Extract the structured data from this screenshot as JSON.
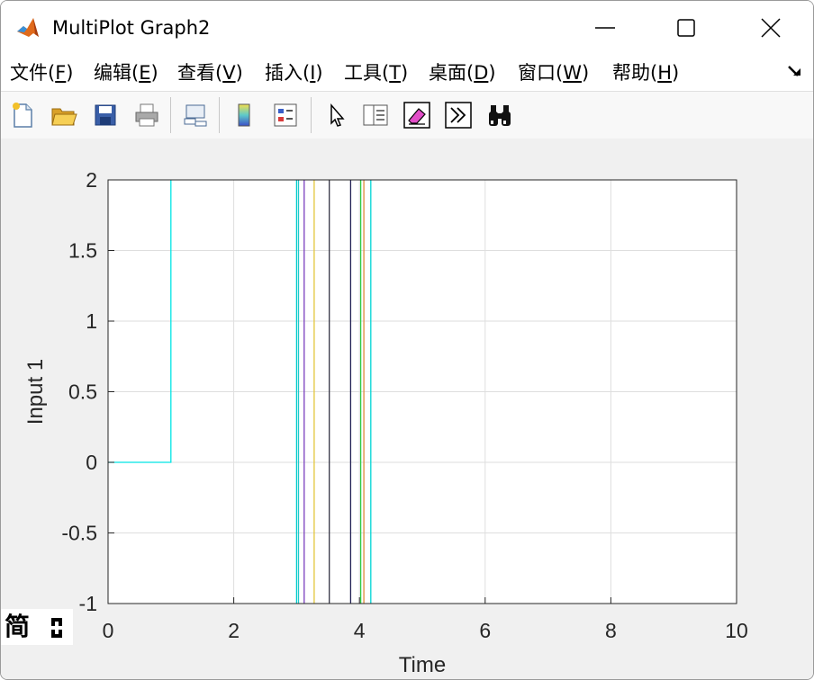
{
  "window": {
    "title": "MultiPlot Graph2"
  },
  "menu": {
    "items": [
      {
        "name": "file",
        "label": "文件(",
        "key": "F",
        "tail": ")"
      },
      {
        "name": "edit",
        "label": "编辑(",
        "key": "E",
        "tail": ")"
      },
      {
        "name": "view",
        "label": "查看(",
        "key": "V",
        "tail": ")"
      },
      {
        "name": "insert",
        "label": "插入(",
        "key": "I",
        "tail": ")"
      },
      {
        "name": "tools",
        "label": "工具(",
        "key": "T",
        "tail": ")"
      },
      {
        "name": "desktop",
        "label": "桌面(",
        "key": "D",
        "tail": ")"
      },
      {
        "name": "window",
        "label": "窗口(",
        "key": "W",
        "tail": ")"
      },
      {
        "name": "help",
        "label": "帮助(",
        "key": "H",
        "tail": ")"
      }
    ]
  },
  "toolbar": {
    "icons": [
      "new-figure-icon",
      "open-file-icon",
      "save-icon",
      "print-icon",
      "link-plot-icon",
      "colorbar-icon",
      "legend-icon",
      "pointer-icon",
      "property-inspector-icon",
      "eraser-icon",
      "more-icon",
      "binoculars-icon"
    ]
  },
  "ime": {
    "label": "简"
  },
  "chart_data": {
    "type": "line",
    "xlabel": "Time",
    "ylabel": "Input 1",
    "xlim": [
      0,
      10
    ],
    "ylim": [
      -1,
      2
    ],
    "xticks": [
      "0",
      "2",
      "4",
      "6",
      "8",
      "10"
    ],
    "yticks": [
      "2",
      "1.5",
      "1",
      "0.5",
      "0",
      "-0.5",
      "-1"
    ],
    "grid": true,
    "series": [
      {
        "color": "#00e5e5",
        "x": [
          0,
          1,
          1
        ],
        "y": [
          0,
          0,
          2
        ]
      },
      {
        "color": "#00cccc",
        "x": [
          3.0,
          3.0
        ],
        "y": [
          -1,
          2
        ]
      },
      {
        "color": "#1ecaca",
        "x": [
          3.03,
          3.03
        ],
        "y": [
          -1,
          2
        ]
      },
      {
        "color": "#7a3fbf",
        "x": [
          3.12,
          3.12
        ],
        "y": [
          -1,
          2
        ]
      },
      {
        "color": "#e3c53a",
        "x": [
          3.28,
          3.28
        ],
        "y": [
          -1,
          2
        ]
      },
      {
        "color": "#333344",
        "x": [
          3.52,
          3.52
        ],
        "y": [
          -1,
          2
        ]
      },
      {
        "color": "#222255",
        "x": [
          3.86,
          3.86
        ],
        "y": [
          -1,
          2
        ]
      },
      {
        "color": "#2ecc40",
        "x": [
          4.02,
          4.02
        ],
        "y": [
          -1,
          2
        ]
      },
      {
        "color": "#e08a3a",
        "x": [
          4.07,
          4.07
        ],
        "y": [
          -1,
          2
        ]
      },
      {
        "color": "#00d6d6",
        "x": [
          4.18,
          4.18
        ],
        "y": [
          -1,
          2
        ]
      }
    ]
  }
}
